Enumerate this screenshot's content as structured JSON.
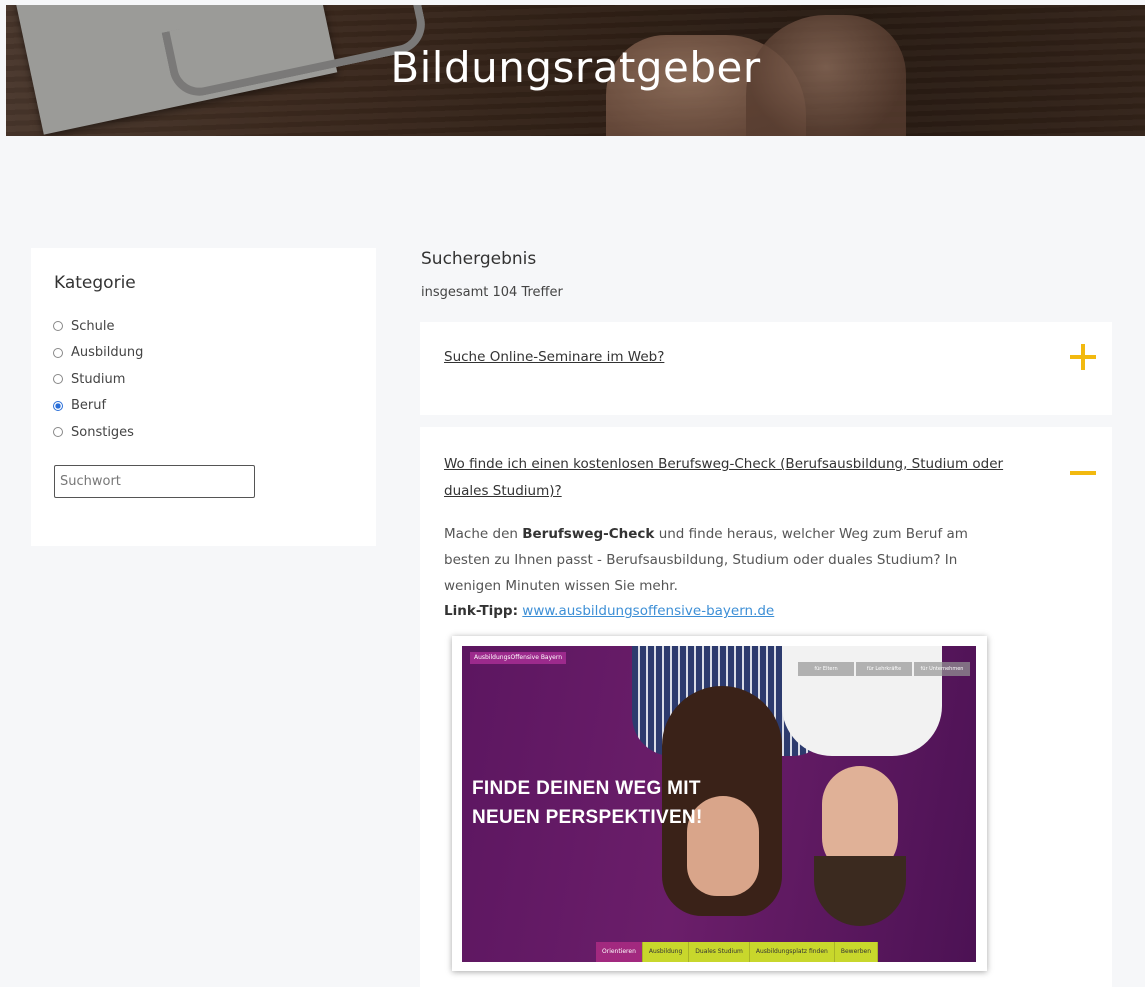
{
  "header": {
    "title": "Bildungsratgeber"
  },
  "sidebar": {
    "heading": "Kategorie",
    "categories": [
      {
        "label": "Schule",
        "checked": false
      },
      {
        "label": "Ausbildung",
        "checked": false
      },
      {
        "label": "Studium",
        "checked": false
      },
      {
        "label": "Beruf",
        "checked": true
      },
      {
        "label": "Sonstiges",
        "checked": false
      }
    ],
    "search_placeholder": "Suchwort"
  },
  "results": {
    "title": "Suchergebnis",
    "count_text": "insgesamt 104 Treffer",
    "items": [
      {
        "question": "Suche Online-Seminare im Web?",
        "toggle_icon": "plus-icon"
      },
      {
        "question": "Wo finde ich einen kostenlosen Berufsweg-Check (Berufsausbildung, Studium oder duales Studium)?",
        "toggle_icon": "minus-icon",
        "answer_before": "Mache den ",
        "answer_bold": "Berufsweg-Check",
        "answer_after": " und finde heraus, welcher Weg zum Beruf am besten zu Ihnen passt - Berufsausbildung, Studium oder duales Studium? In wenigen Minuten wissen Sie mehr.",
        "tip_label": "Link-Tipp:",
        "tip_link": "www.ausbildungsoffensive-bayern.de",
        "image": {
          "logo": "AusbildungsOffensive Bayern",
          "headline_line1": "FINDE DEINEN WEG MIT",
          "headline_line2": "NEUEN PERSPEKTIVEN!",
          "nav": [
            "für Eltern",
            "für Lehrkräfte",
            "für Unternehmen"
          ],
          "tabs": [
            "Orientieren",
            "Ausbildung",
            "Duales Studium",
            "Ausbildungsplatz finden",
            "Bewerben"
          ],
          "accent": "#a2297f",
          "tab_color": "#c8d72c"
        }
      }
    ]
  },
  "colors": {
    "toggle_accent": "#f2b90f",
    "link_blue": "#3d8fd6"
  }
}
